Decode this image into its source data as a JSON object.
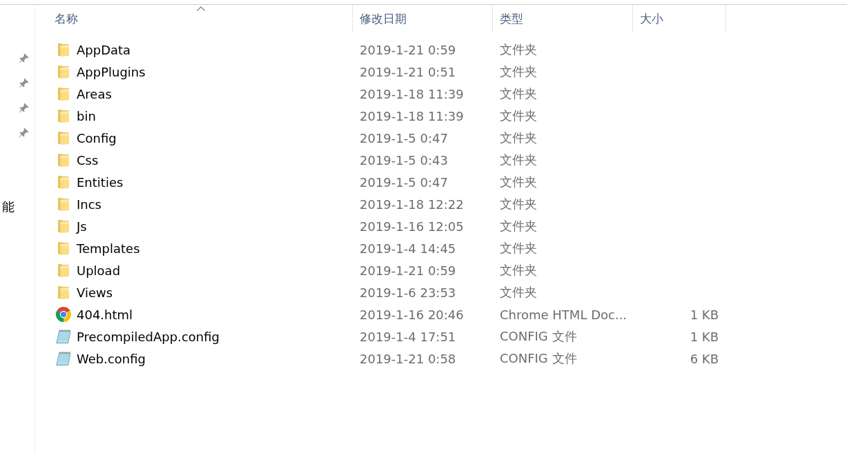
{
  "navigation_pane": {
    "pinned_items": [
      {
        "pinned": true
      },
      {
        "pinned": true
      },
      {
        "pinned": true
      },
      {
        "pinned": true
      }
    ],
    "items": [
      {
        "label": "能"
      }
    ]
  },
  "columns": [
    {
      "label": "名称",
      "sorted": true
    },
    {
      "label": "修改日期",
      "sorted": false
    },
    {
      "label": "类型",
      "sorted": false
    },
    {
      "label": "大小",
      "sorted": false
    }
  ],
  "rows": [
    {
      "kind": "folder",
      "name": "AppData",
      "date": "2019-1-21 0:59",
      "type": "文件夹"
    },
    {
      "kind": "folder",
      "name": "AppPlugins",
      "date": "2019-1-21 0:51",
      "type": "文件夹"
    },
    {
      "kind": "folder",
      "name": "Areas",
      "date": "2019-1-18 11:39",
      "type": "文件夹"
    },
    {
      "kind": "folder",
      "name": "bin",
      "date": "2019-1-18 11:39",
      "type": "文件夹"
    },
    {
      "kind": "folder",
      "name": "Config",
      "date": "2019-1-5 0:47",
      "type": "文件夹"
    },
    {
      "kind": "folder",
      "name": "Css",
      "date": "2019-1-5 0:43",
      "type": "文件夹"
    },
    {
      "kind": "folder",
      "name": "Entities",
      "date": "2019-1-5 0:47",
      "type": "文件夹"
    },
    {
      "kind": "folder",
      "name": "Incs",
      "date": "2019-1-18 12:22",
      "type": "文件夹"
    },
    {
      "kind": "folder",
      "name": "Js",
      "date": "2019-1-16 12:05",
      "type": "文件夹"
    },
    {
      "kind": "folder",
      "name": "Templates",
      "date": "2019-1-4 14:45",
      "type": "文件夹"
    },
    {
      "kind": "folder",
      "name": "Upload",
      "date": "2019-1-21 0:59",
      "type": "文件夹"
    },
    {
      "kind": "folder",
      "name": "Views",
      "date": "2019-1-6 23:53",
      "type": "文件夹"
    },
    {
      "kind": "html",
      "name": "404.html",
      "date": "2019-1-16 20:46",
      "type": "Chrome HTML Doc...",
      "size": "1 KB"
    },
    {
      "kind": "config",
      "name": "PrecompiledApp.config",
      "date": "2019-1-4 17:51",
      "type": "CONFIG 文件",
      "size": "1 KB"
    },
    {
      "kind": "config",
      "name": "Web.config",
      "date": "2019-1-21 0:58",
      "type": "CONFIG 文件",
      "size": "6 KB"
    }
  ]
}
